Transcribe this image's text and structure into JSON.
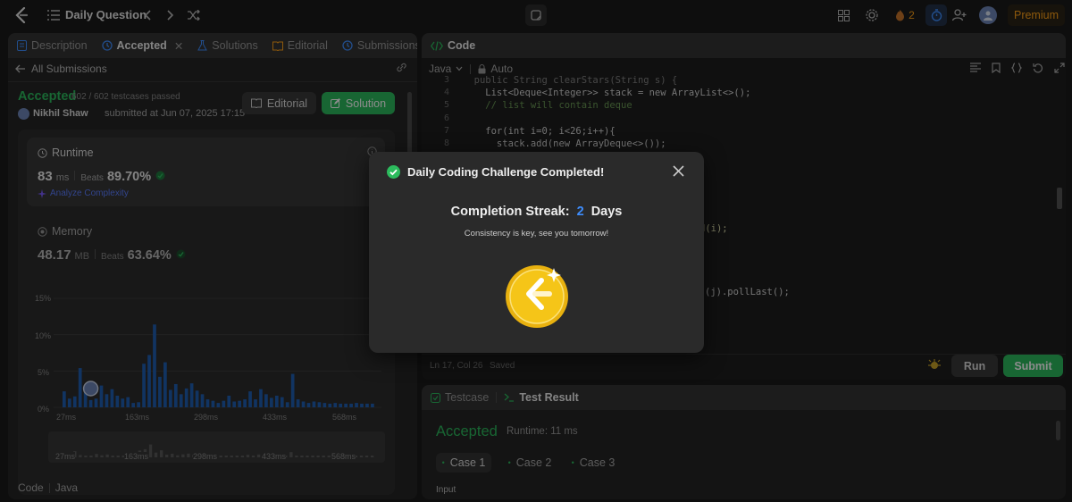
{
  "topbar": {
    "title": "Daily Question",
    "streak_count": "2",
    "premium_label": "Premium"
  },
  "left_panel": {
    "tabs": [
      {
        "label": "Description"
      },
      {
        "label": "Accepted"
      },
      {
        "label": "Solutions"
      },
      {
        "label": "Editorial"
      },
      {
        "label": "Submissions"
      }
    ],
    "back_label": "All Submissions",
    "status": "Accepted",
    "testcases": "602 / 602 testcases passed",
    "user": "Nikhil Shaw",
    "submitted_at": "submitted at Jun 07, 2025 17:15",
    "editorial_button": "Editorial",
    "solution_button": "Solution",
    "runtime": {
      "title": "Runtime",
      "value": "83",
      "unit": "ms",
      "beats_label": "Beats",
      "beats": "89.70%",
      "analyze": "Analyze Complexity"
    },
    "memory": {
      "title": "Memory",
      "value": "48.17",
      "unit": "MB",
      "beats_label": "Beats",
      "beats": "63.64%"
    },
    "footer": {
      "code_label": "Code",
      "language": "Java"
    }
  },
  "chart_data": {
    "type": "bar",
    "y_ticks": [
      "15%",
      "10%",
      "5%",
      "0%"
    ],
    "ylim": [
      0,
      15
    ],
    "x_ticks": [
      "27ms",
      "163ms",
      "298ms",
      "433ms",
      "568ms"
    ],
    "overview_ticks": [
      "27ms",
      "163ms",
      "298ms",
      "433ms",
      "568ms"
    ],
    "values": [
      2.2,
      1.2,
      1.5,
      5.4,
      2.1,
      1.0,
      1.2,
      3.0,
      1.8,
      2.5,
      1.6,
      1.2,
      1.4,
      0.6,
      0.7,
      6.0,
      7.2,
      11.4,
      4.2,
      6.2,
      2.4,
      3.2,
      1.8,
      2.6,
      3.3,
      2.3,
      1.8,
      1.1,
      0.9,
      0.6,
      0.9,
      1.6,
      0.8,
      0.9,
      1.1,
      2.2,
      1.1,
      2.5,
      1.8,
      1.3,
      1.6,
      1.4,
      0.7,
      4.6,
      1.1,
      0.8,
      0.6,
      0.8,
      0.7,
      0.6,
      0.5,
      0.6,
      0.5,
      0.5,
      0.5,
      0.6,
      0.5,
      0.5,
      0.5
    ],
    "highlight_index": 5
  },
  "code_panel": {
    "title": "Code",
    "language": "Java",
    "autosave": "Auto",
    "status_pos": "Ln 17, Col 26",
    "status_saved": "Saved",
    "run_label": "Run",
    "submit_label": "Submit"
  },
  "code_lines": [
    {
      "n": "3",
      "text": "  public String clearStars(String s) {"
    },
    {
      "n": "4",
      "text": "    List<Deque<Integer>> stack = new ArrayList<>();"
    },
    {
      "n": "5",
      "text": "    // list will contain deque"
    },
    {
      "n": "6",
      "text": ""
    },
    {
      "n": "7",
      "text": "    for(int i=0; i<26;i++){"
    },
    {
      "n": "8",
      "text": "      stack.add(new ArrayDeque<>());"
    }
  ],
  "code_fragments": {
    "f1": "d(i);",
    "f2": "(j).pollLast();"
  },
  "result_panel": {
    "testcase_tab": "Testcase",
    "result_tab": "Test Result",
    "status": "Accepted",
    "runtime": "Runtime: 11 ms",
    "cases": [
      "Case 1",
      "Case 2",
      "Case 3"
    ],
    "input_label": "Input"
  },
  "modal": {
    "title": "Daily Coding Challenge Completed!",
    "streak_label": "Completion Streak:",
    "streak_value": "2",
    "streak_unit": "Days",
    "message": "Consistency is key, see you tomorrow!"
  },
  "colors": {
    "accent_green": "#2cbb5d",
    "accent_blue": "#3e8eff",
    "brand_orange": "#ffa116",
    "bar_blue": "#1f5fb3",
    "coin_gold": "#f5c518"
  }
}
